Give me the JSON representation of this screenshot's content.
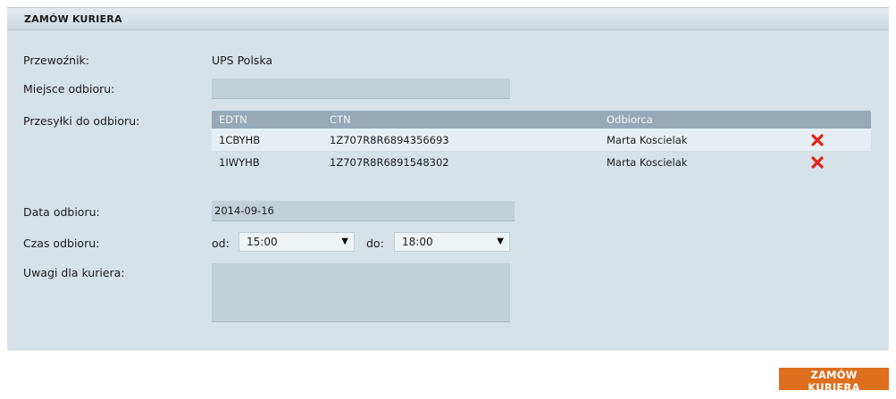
{
  "panel": {
    "title": "ZAMÓW KURIERA"
  },
  "carrier": {
    "label": "Przewoźnik:",
    "value": "UPS Polska"
  },
  "pickup_place": {
    "label": "Miejsce odbioru:",
    "value": ""
  },
  "shipments": {
    "label": "Przesyłki do odbioru:",
    "columns": {
      "edtn": "EDTN",
      "ctn": "CTN",
      "recipient": "Odbiorca"
    },
    "rows": [
      {
        "edtn": "1CBYHB",
        "ctn": "1Z707R8R6894356693",
        "recipient": "Marta Koscielak"
      },
      {
        "edtn": "1IWYHB",
        "ctn": "1Z707R8R6891548302",
        "recipient": "Marta Koscielak"
      }
    ],
    "delete_icon": "red-x-icon",
    "delete_color": "#e2231a"
  },
  "pickup_date": {
    "label": "Data odbioru:",
    "value": "2014-09-16"
  },
  "pickup_time": {
    "label": "Czas odbioru:",
    "from_label": "od:",
    "from_value": "15:00",
    "to_label": "do:",
    "to_value": "18:00"
  },
  "notes": {
    "label": "Uwagi dla kuriera:",
    "value": ""
  },
  "order_button": {
    "label": "ZAMÓW KURIERA",
    "color": "#dd6e1d"
  }
}
